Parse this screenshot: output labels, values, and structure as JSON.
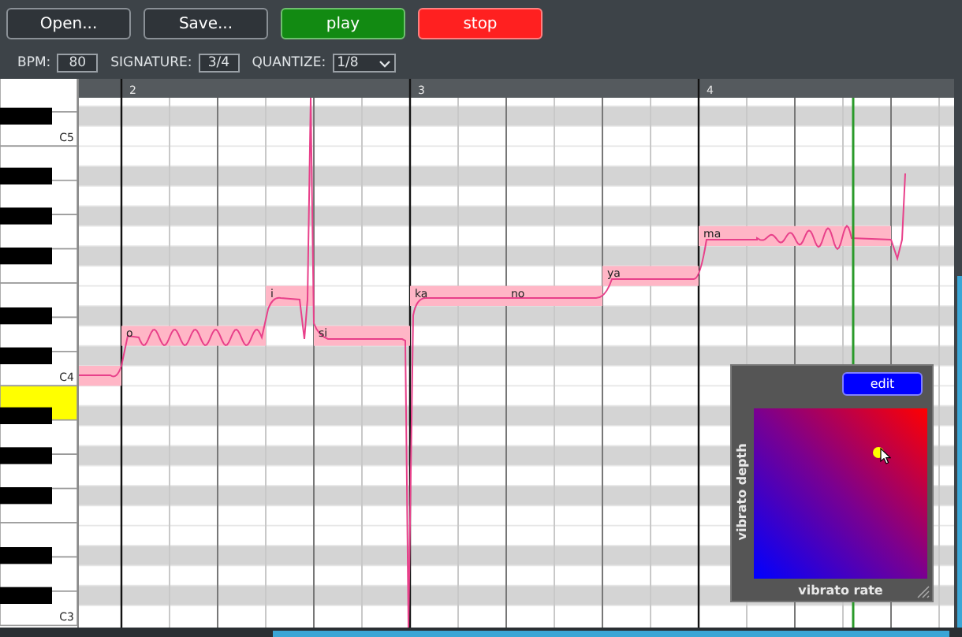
{
  "toolbar": {
    "buttons": [
      {
        "label": "Open...",
        "kind": "plain"
      },
      {
        "label": "Save...",
        "kind": "plain"
      },
      {
        "label": "play",
        "kind": "go"
      },
      {
        "label": "stop",
        "kind": "halt"
      }
    ]
  },
  "settings": {
    "bpm": {
      "label": "BPM:",
      "value": "80"
    },
    "signature": {
      "label": "SIGNATURE:",
      "value": "3/4"
    },
    "quantize": {
      "label": "QUANTIZE:",
      "value": "1/8"
    }
  },
  "ruler": {
    "measures": [
      "2",
      "3",
      "4"
    ]
  },
  "keyboard": {
    "labels": [
      "C5",
      "C4",
      "C3"
    ],
    "white_keys": [
      {
        "selected": false
      },
      {
        "selected": false
      },
      {
        "selected": false
      },
      {
        "selected": false
      },
      {
        "selected": false
      },
      {
        "selected": false
      },
      {
        "selected": false
      },
      {
        "selected": false
      },
      {
        "selected": false
      },
      {
        "selected": true
      },
      {
        "selected": false
      },
      {
        "selected": false
      },
      {
        "selected": false
      },
      {
        "selected": false
      },
      {
        "selected": false
      },
      {
        "selected": false
      }
    ]
  },
  "notes": [
    {
      "lyric": "o"
    },
    {
      "lyric": "i"
    },
    {
      "lyric": "si"
    },
    {
      "lyric": "ka"
    },
    {
      "lyric": "no"
    },
    {
      "lyric": "ya"
    },
    {
      "lyric": "ma"
    }
  ],
  "vibrato_panel": {
    "button": "edit",
    "x_axis": {
      "label": "vibrato rate",
      "level": 0.72
    },
    "y_axis": {
      "label": "vibrato depth",
      "level": 0.74
    }
  }
}
